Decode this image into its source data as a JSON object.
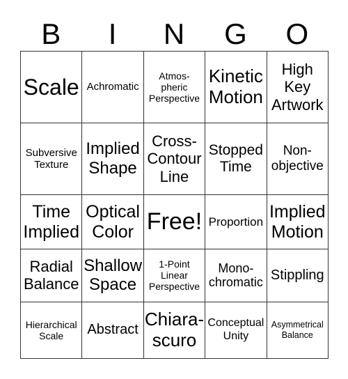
{
  "header": [
    "B",
    "I",
    "N",
    "G",
    "O"
  ],
  "rows": [
    [
      "Scale",
      "Achromatic",
      "Atmos-\npheric\nPerspective",
      "Kinetic\nMotion",
      "High\nKey\nArtwork"
    ],
    [
      "Subversive\nTexture",
      "Implied\nShape",
      "Cross-\nContour\nLine",
      "Stopped\nTime",
      "Non-\nobjective"
    ],
    [
      "Time\nImplied",
      "Optical\nColor",
      "Free!",
      "Proportion",
      "Implied\nMotion"
    ],
    [
      "Radial\nBalance",
      "Shallow\nSpace",
      "1-Point\nLinear\nPerspective",
      "Mono-\nchromatic",
      "Stippling"
    ],
    [
      "Hierarchical\nScale",
      "Abstract",
      "Chiara-\nscuro",
      "Conceptual\nUnity",
      "Asymmetrical\nBalance"
    ]
  ]
}
